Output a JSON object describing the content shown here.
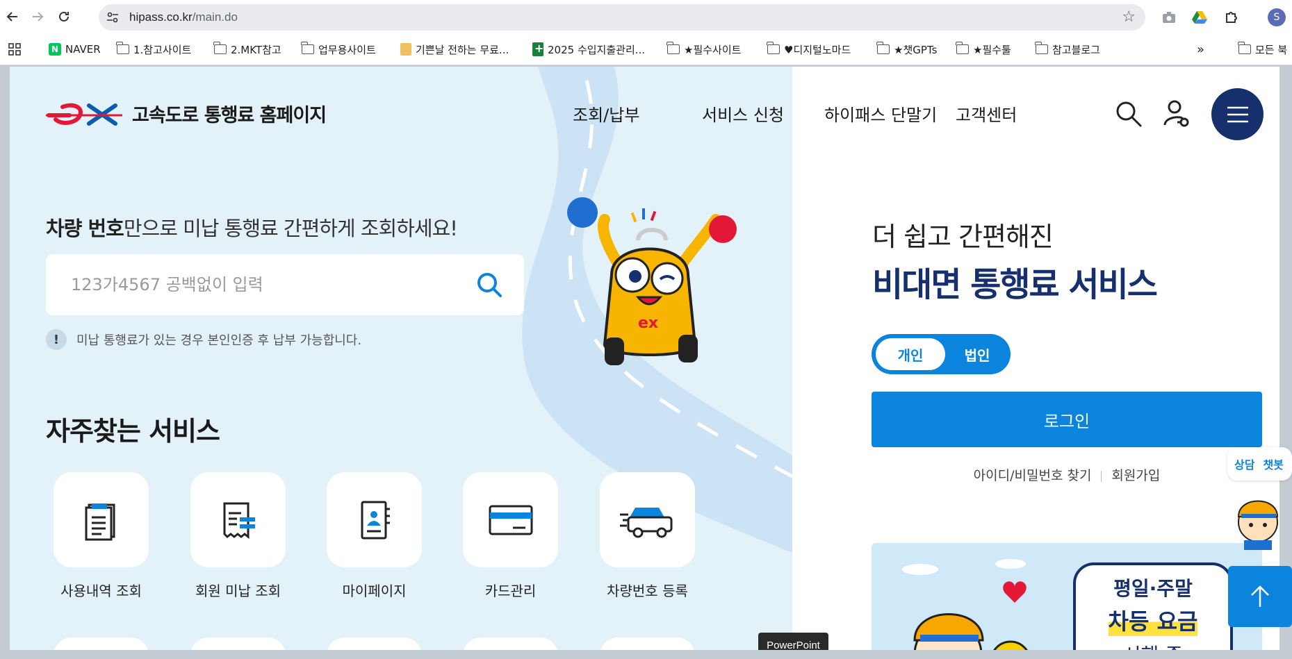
{
  "browser": {
    "url_host": "hipass.co.kr",
    "url_path": "/main.do",
    "profile_initial": "S",
    "bookmarks": [
      {
        "label": "NAVER",
        "icon": "naver-icon"
      },
      {
        "label": "1.참고사이트",
        "icon": "folder-icon"
      },
      {
        "label": "2.MKT참고",
        "icon": "folder-icon"
      },
      {
        "label": "업무용사이트",
        "icon": "folder-icon"
      },
      {
        "label": "기쁜날 전하는 무료...",
        "icon": "doc-icon"
      },
      {
        "label": "2025 수입지출관리...",
        "icon": "sheets-icon"
      },
      {
        "label": "★필수사이트",
        "icon": "folder-icon"
      },
      {
        "label": "♥디지털노마드",
        "icon": "folder-icon"
      },
      {
        "label": "★챗GPTs",
        "icon": "folder-icon"
      },
      {
        "label": "★필수툴",
        "icon": "folder-icon"
      },
      {
        "label": "참고블로그",
        "icon": "folder-icon"
      },
      {
        "label": "모든 북",
        "icon": "folder-icon"
      }
    ],
    "overflow_label": "»"
  },
  "site": {
    "logo_text": "고속도로 통행료 홈페이지",
    "nav": [
      "조회/납부",
      "서비스 신청",
      "하이패스 단말기",
      "고객센터"
    ]
  },
  "search": {
    "heading_bold": "차량 번호",
    "heading_rest": "만으로 미납 통행료 간편하게 조회하세요!",
    "placeholder": "123가4567 공백없이 입력",
    "notice_mark": "!",
    "notice": "미납 통행료가 있는 경우 본인인증 후 납부 가능합니다."
  },
  "services": {
    "title": "자주찾는 서비스",
    "items": [
      {
        "label": "사용내역 조회",
        "icon": "clipboard-list-icon"
      },
      {
        "label": "회원 미납 조회",
        "icon": "receipt-icon"
      },
      {
        "label": "마이페이지",
        "icon": "contact-book-icon"
      },
      {
        "label": "카드관리",
        "icon": "credit-card-icon"
      },
      {
        "label": "차량번호 등록",
        "icon": "car-icon"
      }
    ]
  },
  "login": {
    "heading1": "더 쉽고 간편해진",
    "heading2": "비대면 통행료 서비스",
    "toggle_personal": "개인",
    "toggle_corporate": "법인",
    "button": "로그인",
    "find_link": "아이디/비밀번호 찾기",
    "join_link": "회원가입"
  },
  "banner": {
    "line1": "평일·주말",
    "line2": "차등 요금",
    "line3": "시행 중"
  },
  "chat": {
    "label1": "상담",
    "label2": "챗봇"
  },
  "tooltip": "PowerPoint",
  "colors": {
    "accent": "#0b84de",
    "navy": "#16306e",
    "brand_red": "#e31837"
  }
}
